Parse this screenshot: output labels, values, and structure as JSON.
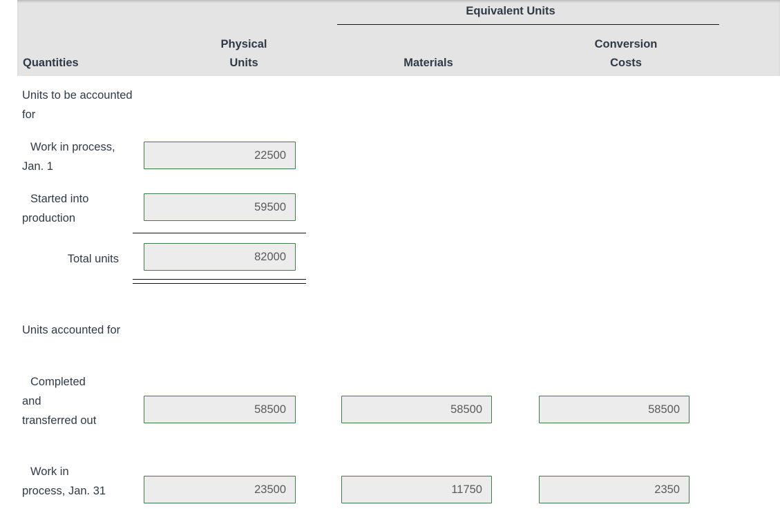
{
  "table": {
    "headers": {
      "equivalent_units": "Equivalent Units",
      "quantities": "Quantities",
      "physical_units": "Physical\nUnits",
      "physical_units_line1": "Physical",
      "physical_units_line2": "Units",
      "materials": "Materials",
      "conversion_costs_line1": "Conversion",
      "conversion_costs_line2": "Costs"
    },
    "sections": [
      {
        "title": "Units to be accounted for",
        "rows": [
          {
            "label": "Work in process, Jan. 1",
            "kind": "item",
            "physical_units": "22500",
            "materials": "",
            "conversion_costs": ""
          },
          {
            "label": "Started into production",
            "kind": "item",
            "physical_units": "59500",
            "materials": "",
            "conversion_costs": ""
          },
          {
            "label": "Total units",
            "kind": "total",
            "physical_units": "82000",
            "materials": "",
            "conversion_costs": ""
          }
        ]
      },
      {
        "title": "Units accounted for",
        "rows": [
          {
            "label": "Completed and transferred out",
            "kind": "item",
            "physical_units": "58500",
            "materials": "58500",
            "conversion_costs": "58500"
          },
          {
            "label": "Work in process, Jan. 31",
            "kind": "item",
            "physical_units": "23500",
            "materials": "11750",
            "conversion_costs": "2350"
          }
        ]
      }
    ]
  },
  "colors": {
    "header_band": "#e4e4e4",
    "input_border": "#3d7a48",
    "input_fill": "#ececec",
    "text": "#2f3a47",
    "value_text": "#5a5a5a",
    "rule": "#111111"
  }
}
